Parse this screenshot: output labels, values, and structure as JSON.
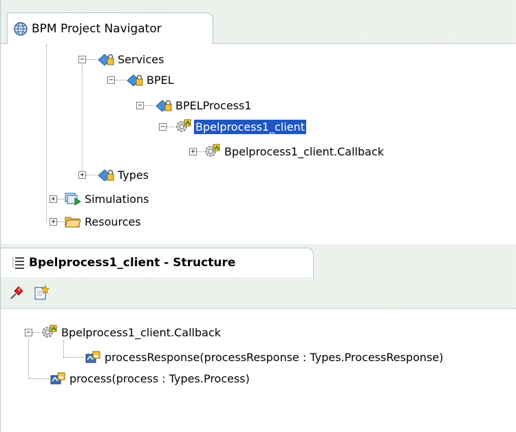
{
  "navigator": {
    "tab_title": "BPM Project Navigator",
    "tree": {
      "services": "Services",
      "bpel": "BPEL",
      "bpel_process": "BPELProcess1",
      "client": "Bpelprocess1_client",
      "client_callback": "Bpelprocess1_client.Callback",
      "types": "Types",
      "simulations": "Simulations",
      "resources": "Resources"
    },
    "selected_item": "Bpelprocess1_client"
  },
  "structure": {
    "tab_title": "Bpelprocess1_client - Structure",
    "toolbar": {
      "pin_icon": "pin-icon",
      "new_icon": "new-item-icon"
    },
    "tree": {
      "callback": "Bpelprocess1_client.Callback",
      "process_response": "processResponse(processResponse : Types.ProcessResponse)",
      "process": "process(process : Types.Process)"
    }
  },
  "colors": {
    "selection": "#2155c0",
    "tab_bg": "#eef3ee",
    "tree_line": "#8c8c8c"
  }
}
